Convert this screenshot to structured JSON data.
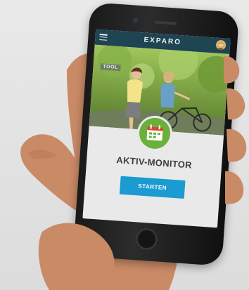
{
  "app": {
    "brand": "EXPARO",
    "badge": "TOOL",
    "title": "AKTIV-MONITOR",
    "start_label": "STARTEN"
  },
  "icons": {
    "menu": "hamburger-menu-icon",
    "avatar": "user-avatar",
    "calendar": "calendar-icon"
  },
  "colors": {
    "topbar": "#1f4452",
    "button": "#1b9bd1",
    "icon_circle": "#6bb03b"
  }
}
